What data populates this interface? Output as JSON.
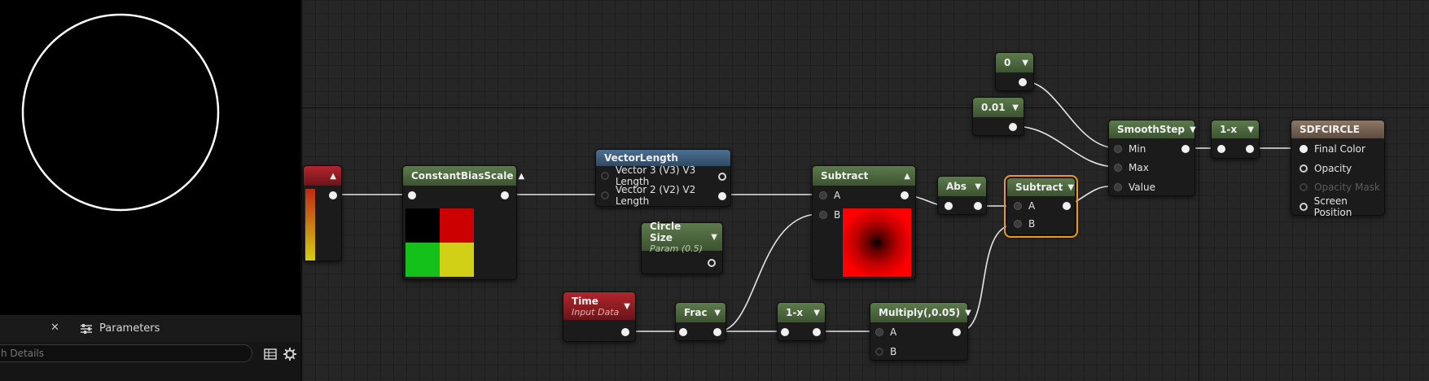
{
  "details": {
    "close_glyph": "✕",
    "tab_label": "Parameters",
    "search_value": "",
    "search_placeholder": "h Details"
  },
  "colors": {
    "header_green": "#4b6a3c",
    "header_blue": "#3e5f7e",
    "header_red": "#921d22",
    "header_tan": "#7a6556",
    "selection": "#e89a1c",
    "wire": "#e6e6e6"
  },
  "nodes": {
    "constant_bias_scale": {
      "title": "ConstantBiasScale"
    },
    "vector_length": {
      "title": "VectorLength",
      "pin_v3": "Vector 3 (V3) V3 Length",
      "pin_v2": "Vector 2 (V2) V2 Length"
    },
    "subtract_1": {
      "title": "Subtract",
      "pin_a": "A",
      "pin_b": "B"
    },
    "circle_size": {
      "title": "Circle Size",
      "subtitle": "Param (0.5)"
    },
    "time": {
      "title": "Time",
      "subtitle": "Input Data"
    },
    "frac": {
      "title": "Frac"
    },
    "one_minus_1": {
      "title": "1-x"
    },
    "multiply": {
      "title": "Multiply(,0.05)",
      "pin_a": "A",
      "pin_b": "B"
    },
    "abs": {
      "title": "Abs"
    },
    "subtract_2": {
      "title": "Subtract",
      "pin_a": "A",
      "pin_b": "B"
    },
    "const_0": {
      "title": "0"
    },
    "const_001": {
      "title": "0.01"
    },
    "smoothstep": {
      "title": "SmoothStep",
      "pin_min": "Min",
      "pin_max": "Max",
      "pin_value": "Value"
    },
    "one_minus_2": {
      "title": "1-x"
    },
    "sdfcircle": {
      "title": "SDFCIRCLE",
      "pin_final_color": "Final Color",
      "pin_opacity": "Opacity",
      "pin_opacity_mask": "Opacity Mask",
      "pin_screen_position": "Screen Position"
    }
  }
}
